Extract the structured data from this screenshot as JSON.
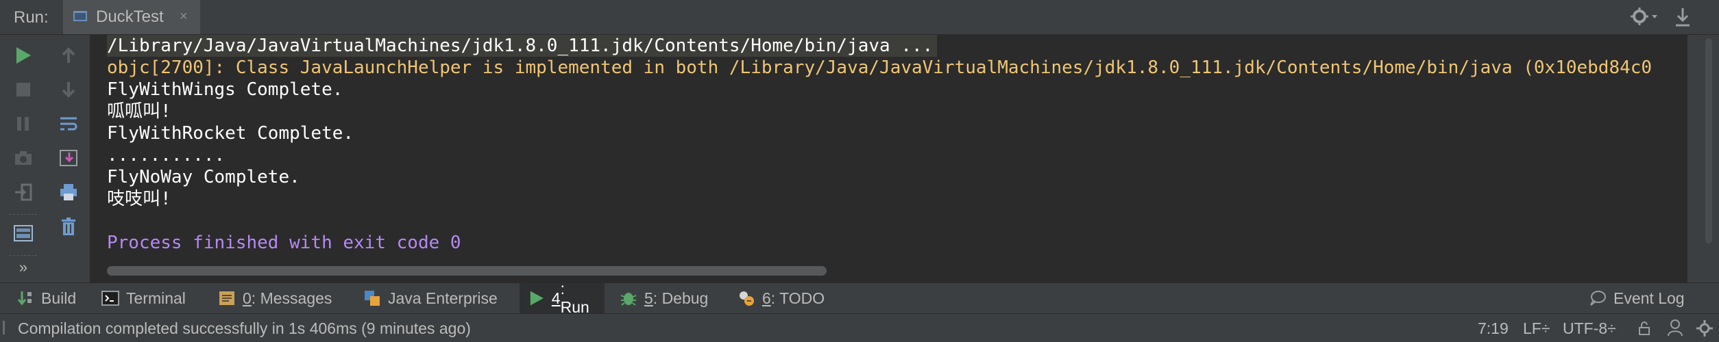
{
  "run_header": {
    "label": "Run:",
    "tab_title": "DuckTest",
    "tab_close": "×"
  },
  "console": {
    "lines": [
      "/Library/Java/JavaVirtualMachines/jdk1.8.0_111.jdk/Contents/Home/bin/java ...",
      "objc[2700]: Class JavaLaunchHelper is implemented in both /Library/Java/JavaVirtualMachines/jdk1.8.0_111.jdk/Contents/Home/bin/java (0x10ebd84c0",
      "FlyWithWings Complete.",
      "呱呱叫!",
      "FlyWithRocket Complete.",
      "...........",
      "FlyNoWay Complete.",
      "吱吱叫!",
      "",
      "Process finished with exit code 0"
    ]
  },
  "tool_windows": {
    "build": {
      "label": "Build"
    },
    "terminal": {
      "label": "Terminal"
    },
    "messages": {
      "mnemonic": "0",
      "label": ": Messages"
    },
    "java_enterprise": {
      "label": "Java Enterprise"
    },
    "run": {
      "mnemonic": "4",
      "label": ": Run"
    },
    "debug": {
      "mnemonic": "5",
      "label": ": Debug"
    },
    "todo": {
      "mnemonic": "6",
      "label": ": TODO"
    },
    "event_log": {
      "label": "Event Log"
    }
  },
  "status_bar": {
    "message": "Compilation completed successfully in 1s 406ms (9 minutes ago)",
    "position": "7:19",
    "line_separator": "LF÷",
    "encoding": "UTF-8÷"
  },
  "colors": {
    "run_green": "#59a869",
    "stderr_yellow": "#f0c674",
    "exit_purple": "#b589f5",
    "console_bg": "#2b2b2b"
  }
}
